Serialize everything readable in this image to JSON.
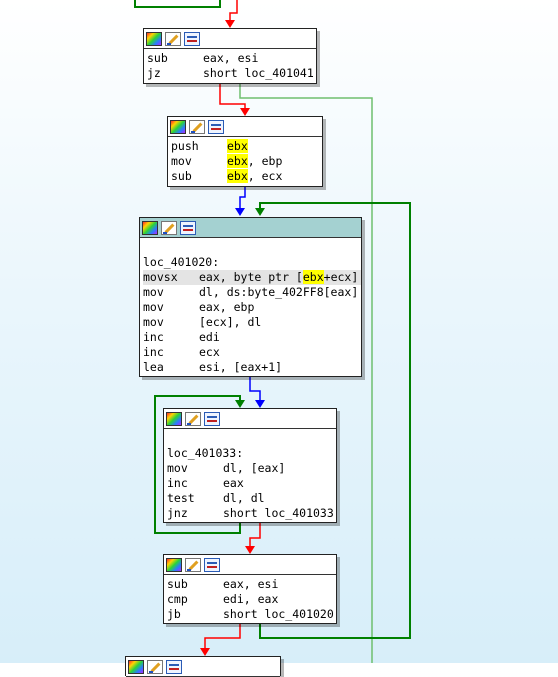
{
  "blocks": {
    "b1": {
      "lines": [
        {
          "mn": "sub",
          "ops": [
            {
              "t": "eax, esi"
            }
          ]
        },
        {
          "mn": "jz",
          "ops": [
            {
              "t": "short loc_401041"
            }
          ]
        }
      ]
    },
    "b2": {
      "lines": [
        {
          "mn": "push",
          "ops": [
            {
              "t": "ebx",
              "hl": true
            }
          ]
        },
        {
          "mn": "mov",
          "ops": [
            {
              "t": "ebx",
              "hl": true
            },
            {
              "t": ", ebp"
            }
          ]
        },
        {
          "mn": "sub",
          "ops": [
            {
              "t": "ebx",
              "hl": true
            },
            {
              "t": ", ecx"
            }
          ]
        }
      ]
    },
    "b3": {
      "label": "loc_401020:",
      "lines": [
        {
          "mn": "movsx",
          "ops": [
            {
              "t": "eax, byte ptr ["
            },
            {
              "t": "ebx",
              "hl": true
            },
            {
              "t": "+ecx]"
            }
          ],
          "row_hl": true
        },
        {
          "mn": "mov",
          "ops": [
            {
              "t": "dl, ds:byte_402FF8[eax]"
            }
          ]
        },
        {
          "mn": "mov",
          "ops": [
            {
              "t": "eax, ebp"
            }
          ]
        },
        {
          "mn": "mov",
          "ops": [
            {
              "t": "[ecx], dl"
            }
          ]
        },
        {
          "mn": "inc",
          "ops": [
            {
              "t": "edi"
            }
          ]
        },
        {
          "mn": "inc",
          "ops": [
            {
              "t": "ecx"
            }
          ]
        },
        {
          "mn": "lea",
          "ops": [
            {
              "t": "esi, [eax+1]"
            }
          ]
        }
      ]
    },
    "b4": {
      "label": "loc_401033:",
      "lines": [
        {
          "mn": "mov",
          "ops": [
            {
              "t": "dl, [eax]"
            }
          ]
        },
        {
          "mn": "inc",
          "ops": [
            {
              "t": "eax"
            }
          ]
        },
        {
          "mn": "test",
          "ops": [
            {
              "t": "dl, dl"
            }
          ]
        },
        {
          "mn": "jnz",
          "ops": [
            {
              "t": "short loc_401033"
            }
          ]
        }
      ]
    },
    "b5": {
      "lines": [
        {
          "mn": "sub",
          "ops": [
            {
              "t": "eax, esi"
            }
          ]
        },
        {
          "mn": "cmp",
          "ops": [
            {
              "t": "edi, eax"
            }
          ]
        },
        {
          "mn": "jb",
          "ops": [
            {
              "t": "short loc_401020"
            }
          ]
        }
      ]
    }
  },
  "colors": {
    "edge_true": "#008000",
    "edge_false": "#ff0000",
    "edge_uncond": "#0000ff",
    "edge_far": "#6fbf6f",
    "highlight": "#ffff00",
    "selected_header": "#a4d1d1"
  }
}
